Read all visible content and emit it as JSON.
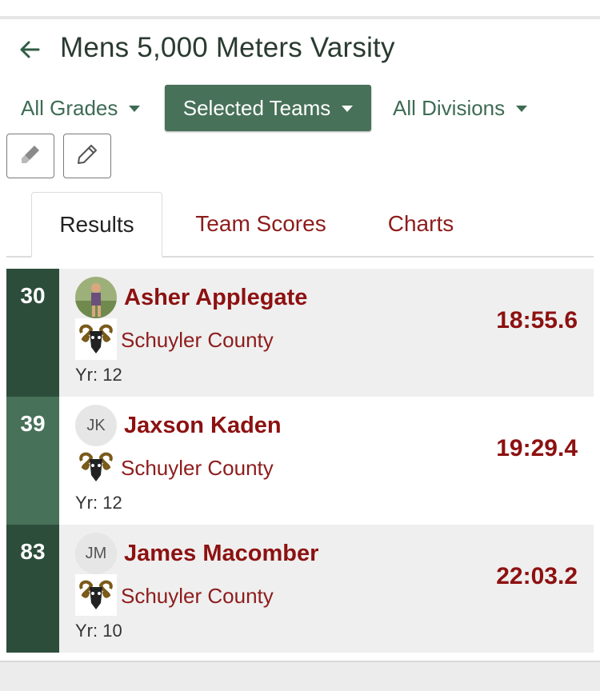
{
  "header": {
    "title": "Mens 5,000 Meters Varsity"
  },
  "filters": {
    "grades": "All Grades",
    "teams": "Selected Teams",
    "divisions": "All Divisions"
  },
  "tabs": {
    "results": "Results",
    "team_scores": "Team Scores",
    "charts": "Charts"
  },
  "results": [
    {
      "place": "30",
      "name": "Asher Applegate",
      "avatar": "photo",
      "team": "Schuyler County",
      "year": "Yr: 12",
      "time": "18:55.6"
    },
    {
      "place": "39",
      "name": "Jaxson Kaden",
      "avatar": "JK",
      "team": "Schuyler County",
      "year": "Yr: 12",
      "time": "19:29.4"
    },
    {
      "place": "83",
      "name": "James Macomber",
      "avatar": "JM",
      "team": "Schuyler County",
      "year": "Yr: 10",
      "time": "22:03.2"
    }
  ],
  "colors": {
    "accent_green": "#477158",
    "dark_green": "#2d4d3b",
    "maroon": "#8d1111"
  },
  "icons": [
    "back-arrow-icon",
    "caret-down-icon",
    "highlighter-icon",
    "pencil-icon",
    "ram-logo-icon"
  ]
}
